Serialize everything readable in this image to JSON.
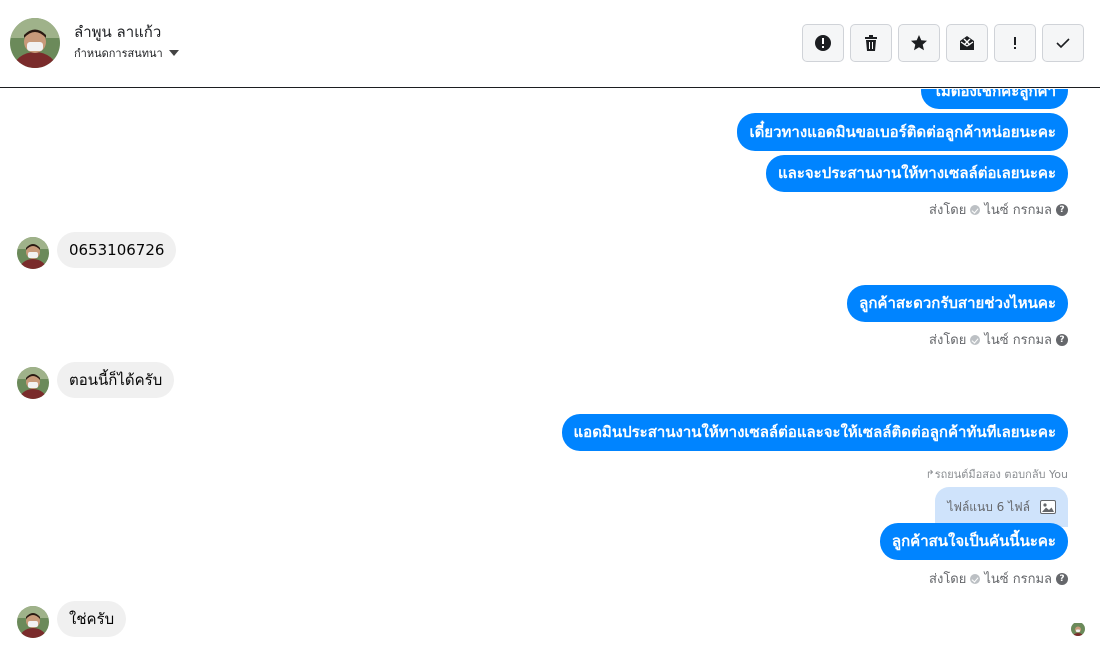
{
  "header": {
    "contact_name": "ลำพูน ลาแก้ว",
    "assign_label": "กำหนดการสนทนา",
    "toolbar": [
      {
        "name": "spam-button",
        "icon": "alert-circle-icon"
      },
      {
        "name": "delete-button",
        "icon": "trash-icon"
      },
      {
        "name": "star-button",
        "icon": "star-icon"
      },
      {
        "name": "mark-unread-button",
        "icon": "envelope-x-icon"
      },
      {
        "name": "important-button",
        "icon": "exclamation-icon"
      },
      {
        "name": "done-button",
        "icon": "check-icon"
      }
    ]
  },
  "messages": {
    "m1": "ไม่ต้องเช็กค่ะลูกค้า",
    "m2": "เดี๋ยวทางแอดมินขอเบอร์ติดต่อลูกค้าหน่อยนะคะ",
    "m3": "และจะประสานงานให้ทางเซลล์ต่อเลยนะคะ",
    "sent_by_1": "ส่งโดย",
    "sender_1": "ไนซ์ กรกมล",
    "in1": "0653106726",
    "m4": "ลูกค้าสะดวกรับสายช่วงไหนคะ",
    "sent_by_2": "ส่งโดย",
    "sender_2": "ไนซ์ กรกมล",
    "in2": "ตอนนี้ก็ได้ครับ",
    "m5": "แอดมินประสานงานให้ทางเซลล์ต่อและจะให้เซลล์ติดต่อลูกค้าทันทีเลยนะคะ",
    "reply_note": "↱รถยนต์มือสอง ตอบกลับ You",
    "attachment": "ไฟล์แนบ 6 ไฟล์",
    "m6": "ลูกค้าสนใจเป็นคันนี้นะคะ",
    "sent_by_3": "ส่งโดย",
    "sender_3": "ไนซ์ กรกมล",
    "in3": "ใช่ครับ"
  },
  "colors": {
    "outgoing_bubble": "#0084ff",
    "incoming_bubble": "#f0f0f0",
    "attachment_bubble": "#cfe3fb"
  }
}
